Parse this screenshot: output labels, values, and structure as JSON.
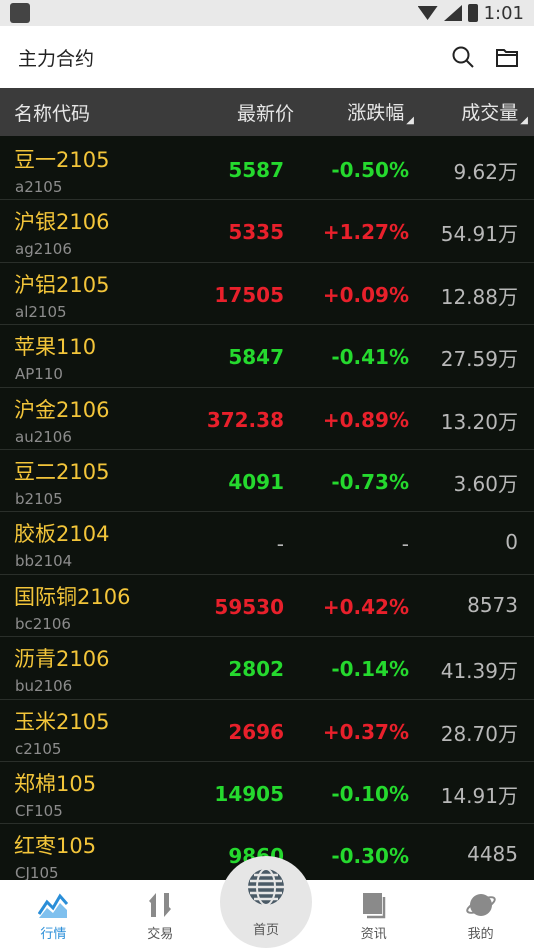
{
  "status_bar": {
    "time": "1:01"
  },
  "app_bar": {
    "title": "主力合约"
  },
  "table_header": {
    "name": "名称代码",
    "price": "最新价",
    "change": "涨跌幅",
    "volume": "成交量"
  },
  "rows": [
    {
      "name": "豆一2105",
      "code": "a2105",
      "price": "5587",
      "change": "-0.50%",
      "volume": "9.62万",
      "dir": "down"
    },
    {
      "name": "沪银2106",
      "code": "ag2106",
      "price": "5335",
      "change": "+1.27%",
      "volume": "54.91万",
      "dir": "up"
    },
    {
      "name": "沪铝2105",
      "code": "al2105",
      "price": "17505",
      "change": "+0.09%",
      "volume": "12.88万",
      "dir": "up"
    },
    {
      "name": "苹果110",
      "code": "AP110",
      "price": "5847",
      "change": "-0.41%",
      "volume": "27.59万",
      "dir": "down"
    },
    {
      "name": "沪金2106",
      "code": "au2106",
      "price": "372.38",
      "change": "+0.89%",
      "volume": "13.20万",
      "dir": "up"
    },
    {
      "name": "豆二2105",
      "code": "b2105",
      "price": "4091",
      "change": "-0.73%",
      "volume": "3.60万",
      "dir": "down"
    },
    {
      "name": "胶板2104",
      "code": "bb2104",
      "price": "-",
      "change": "-",
      "volume": "0",
      "dir": "flat"
    },
    {
      "name": "国际铜2106",
      "code": "bc2106",
      "price": "59530",
      "change": "+0.42%",
      "volume": "8573",
      "dir": "up"
    },
    {
      "name": "沥青2106",
      "code": "bu2106",
      "price": "2802",
      "change": "-0.14%",
      "volume": "41.39万",
      "dir": "down"
    },
    {
      "name": "玉米2105",
      "code": "c2105",
      "price": "2696",
      "change": "+0.37%",
      "volume": "28.70万",
      "dir": "up"
    },
    {
      "name": "郑棉105",
      "code": "CF105",
      "price": "14905",
      "change": "-0.10%",
      "volume": "14.91万",
      "dir": "down"
    },
    {
      "name": "红枣105",
      "code": "CJ105",
      "price": "9860",
      "change": "-0.30%",
      "volume": "4485",
      "dir": "down"
    }
  ],
  "tabs": [
    {
      "label": "行情",
      "icon": "market-chart-icon",
      "active": true
    },
    {
      "label": "交易",
      "icon": "trade-arrows-icon",
      "active": false
    },
    {
      "label": "首页",
      "icon": "globe-icon",
      "active": false
    },
    {
      "label": "资讯",
      "icon": "news-document-icon",
      "active": false
    },
    {
      "label": "我的",
      "icon": "planet-icon",
      "active": false
    }
  ],
  "colors": {
    "up": "#e8202b",
    "down": "#25d92e",
    "name": "#f3c53a",
    "accent": "#2a8ed8"
  }
}
